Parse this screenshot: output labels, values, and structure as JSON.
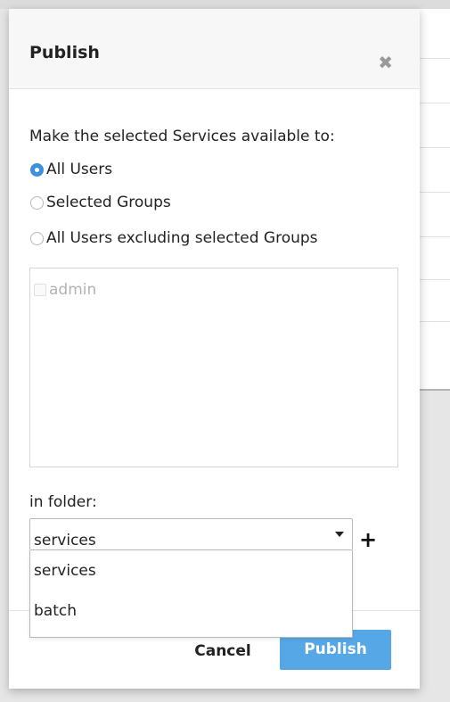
{
  "dialog": {
    "title": "Publish",
    "intro": "Make the selected Services available to:",
    "visibility_options": [
      {
        "label": "All Users",
        "selected": true
      },
      {
        "label": "Selected Groups",
        "selected": false
      },
      {
        "label": "All Users excluding selected Groups",
        "selected": false
      }
    ],
    "groups": [
      {
        "label": "admin",
        "checked": false,
        "disabled": true
      }
    ],
    "folder_label": "in folder:",
    "folder_select": {
      "value": "services",
      "options": [
        "services",
        "batch"
      ],
      "open": true
    },
    "cancel_label": "Cancel",
    "publish_label": "Publish"
  },
  "icons": {
    "close": "close-icon",
    "add_folder": "plus-icon",
    "dropdown": "caret-down-icon"
  },
  "colors": {
    "accent": "#55a7e6",
    "radio_selected": "#3d8fe0"
  }
}
